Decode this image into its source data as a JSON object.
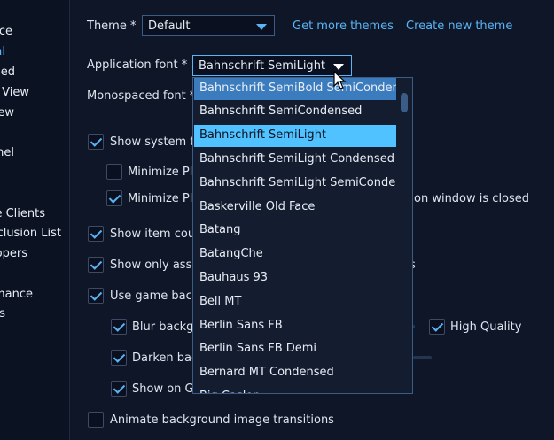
{
  "sidebar": {
    "items": [
      "ce",
      "al",
      "ced",
      " View",
      "ew",
      "nel",
      "e Clients",
      "clusion List",
      "ppers",
      "mance",
      "s"
    ]
  },
  "theme": {
    "label": "Theme *",
    "value": "Default",
    "get_more": "Get more themes",
    "create_new": "Create new theme"
  },
  "app_font": {
    "label": "Application font *",
    "value": "Bahnschrift SemiLight"
  },
  "mono_font": {
    "label": "Monospaced font *"
  },
  "checkboxes": {
    "show_system": "Show system tr",
    "minimize_pl1": "Minimize Pla",
    "minimize_pl2": "Minimize Pla",
    "minimize_pl2_tail": "on window is closed",
    "show_item_count": "Show item cou",
    "show_only": "Show only assi",
    "show_only_tail": "s",
    "use_game_bg": "Use game back",
    "blur_bg": "Blur backgr",
    "high_quality": "High Quality",
    "darken_bg": "Darken bac",
    "show_on": "Show on Gr",
    "animate": "Animate background image transitions"
  },
  "font_dropdown": {
    "options": [
      "Bahnschrift SemiBold SemiConden",
      "Bahnschrift SemiCondensed",
      "Bahnschrift SemiLight",
      "Bahnschrift SemiLight Condensed",
      "Bahnschrift SemiLight SemiConde",
      "Baskerville Old Face",
      "Batang",
      "BatangChe",
      "Bauhaus 93",
      "Bell MT",
      "Berlin Sans FB",
      "Berlin Sans FB Demi",
      "Bernard MT Condensed",
      "Big Caslon"
    ],
    "hovered_index": 0,
    "selected_index": 2
  },
  "colors": {
    "accent": "#5ab4f5",
    "selected": "#4fc2ff",
    "hover": "#3b7cbf",
    "background": "#0e1628"
  }
}
